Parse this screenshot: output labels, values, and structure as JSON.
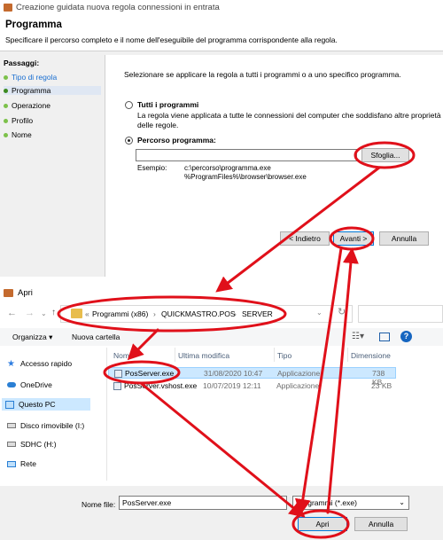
{
  "wizard": {
    "window_title": "Creazione guidata nuova regola connessioni in entrata",
    "heading": "Programma",
    "description": "Specificare il percorso completo e il nome dell'eseguibile del programma corrispondente alla regola.",
    "steps_title": "Passaggi:",
    "steps": [
      "Tipo di regola",
      "Programma",
      "Operazione",
      "Profilo",
      "Nome"
    ],
    "question": "Selezionare se applicare la regola a tutti i programmi o a uno specifico programma.",
    "option_all": {
      "label": "Tutti i programmi",
      "desc_line1": "La regola viene applicata a tutte le connessioni del computer che soddisfano altre proprietà",
      "desc_line2": "delle regole."
    },
    "option_path": {
      "label": "Percorso programma:",
      "value": ""
    },
    "browse_label": "Sfoglia...",
    "example_label": "Esempio:",
    "example_lines": [
      "c:\\percorso\\programma.exe",
      "%ProgramFiles%\\browser\\browser.exe"
    ],
    "back_label": "< Indietro",
    "next_label": "Avanti >",
    "cancel_label": "Annulla"
  },
  "open_dialog": {
    "title": "Apri",
    "breadcrumb": [
      "«",
      "Programmi (x86)",
      "›",
      "QUICKMASTRO.POS",
      "›",
      "SERVER"
    ],
    "organize_label": "Organizza",
    "new_folder_label": "Nuova cartella",
    "nav": [
      "Accesso rapido",
      "OneDrive",
      "Questo PC",
      "Disco rimovibile (I:)",
      "SDHC (H:)",
      "Rete"
    ],
    "columns": {
      "name": "Nome",
      "modified": "Ultima modifica",
      "type": "Tipo",
      "size": "Dimensione"
    },
    "files": [
      {
        "name": "PosServer.exe",
        "modified": "31/08/2020 10:47",
        "type": "Applicazione",
        "size": "738 KB"
      },
      {
        "name": "PosServer.vshost.exe",
        "modified": "10/07/2019 12:11",
        "type": "Applicazione",
        "size": "23 KB"
      }
    ],
    "filename_label": "Nome file:",
    "filename_value": "PosServer.exe",
    "filter_value": "Programmi (*.exe)",
    "open_label": "Apri",
    "cancel_label": "Annulla"
  },
  "colors": {
    "annotation": "#e0101a",
    "selection": "#cce8ff",
    "accent": "#0078d7"
  }
}
